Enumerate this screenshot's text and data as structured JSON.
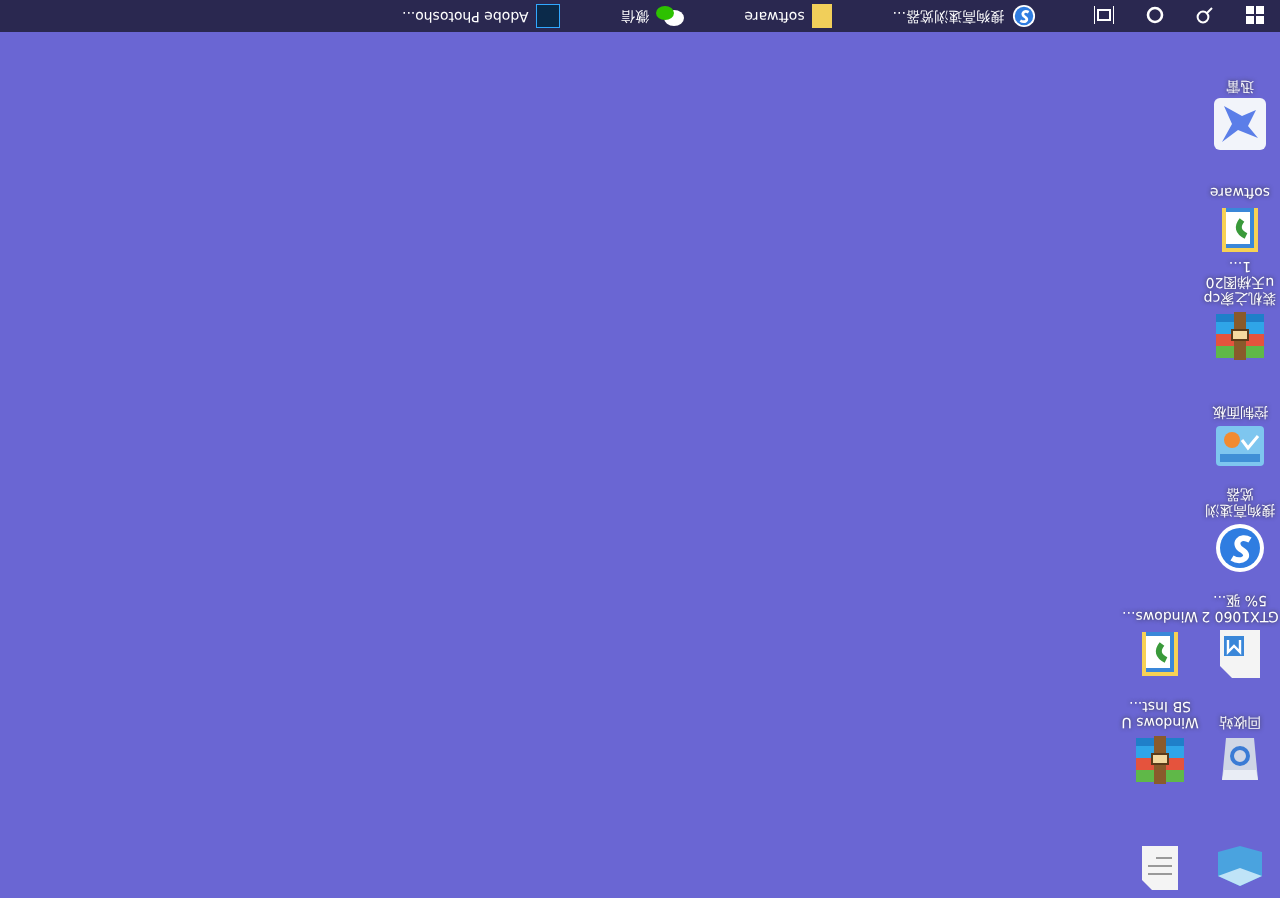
{
  "desktop": {
    "columns": [
      [
        {
          "kind": "box"
        },
        {
          "kind": "recycle",
          "label": "回收站"
        },
        {
          "kind": "doc",
          "label": "GTX1060 25% 驱..."
        },
        {
          "kind": "sogou",
          "label": "搜狗高速浏览器"
        },
        {
          "kind": "control",
          "label": "控制面板"
        },
        {
          "kind": "archive",
          "label": "装机之家cpu天梯图201..."
        },
        {
          "kind": "folder",
          "label": "software"
        },
        {
          "kind": "bird",
          "label": "迅雷"
        }
      ],
      [
        {
          "kind": "textdoc"
        },
        {
          "kind": "archive",
          "label": "Windows USB Inst..."
        },
        {
          "kind": "folder",
          "label": "Windows..."
        }
      ]
    ]
  },
  "taskbar": {
    "apps": [
      {
        "kind": "sogou",
        "label": "搜狗高速浏览器..."
      },
      {
        "kind": "folder",
        "label": "software"
      },
      {
        "kind": "wechat",
        "label": "微信"
      },
      {
        "kind": "photoshop",
        "label": "Adobe Photosho..."
      }
    ]
  }
}
